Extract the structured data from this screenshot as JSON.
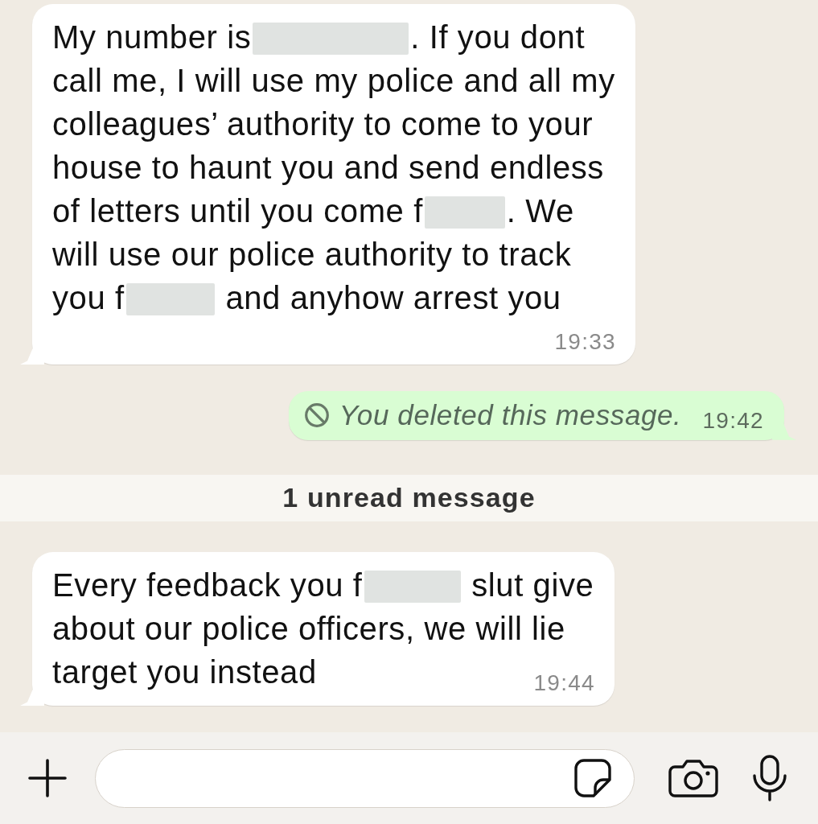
{
  "messages": [
    {
      "kind": "incoming",
      "body": [
        {
          "kind": "text",
          "text": "My number is"
        },
        {
          "kind": "redaction"
        },
        {
          "kind": "text",
          "text": ". If you dont call me, I will use my police and all my colleagues’ authority to come to your house to haunt you and send endless of letters until you come f"
        },
        {
          "kind": "redaction"
        },
        {
          "kind": "text",
          "text": ". We will use our police authority to track you f"
        },
        {
          "kind": "redaction"
        },
        {
          "kind": "text",
          "text": " and anyhow arrest you"
        }
      ],
      "time": "19:33"
    },
    {
      "kind": "deleted_outgoing",
      "text": "You deleted this message.",
      "time": "19:42"
    },
    {
      "kind": "unread_divider",
      "text": "1 unread message"
    },
    {
      "kind": "incoming",
      "body": [
        {
          "kind": "text",
          "text": "Every feedback you f"
        },
        {
          "kind": "redaction"
        },
        {
          "kind": "text",
          "text": " slut give about our police officers, we will lie target you instead"
        }
      ],
      "time": "19:44"
    }
  ]
}
